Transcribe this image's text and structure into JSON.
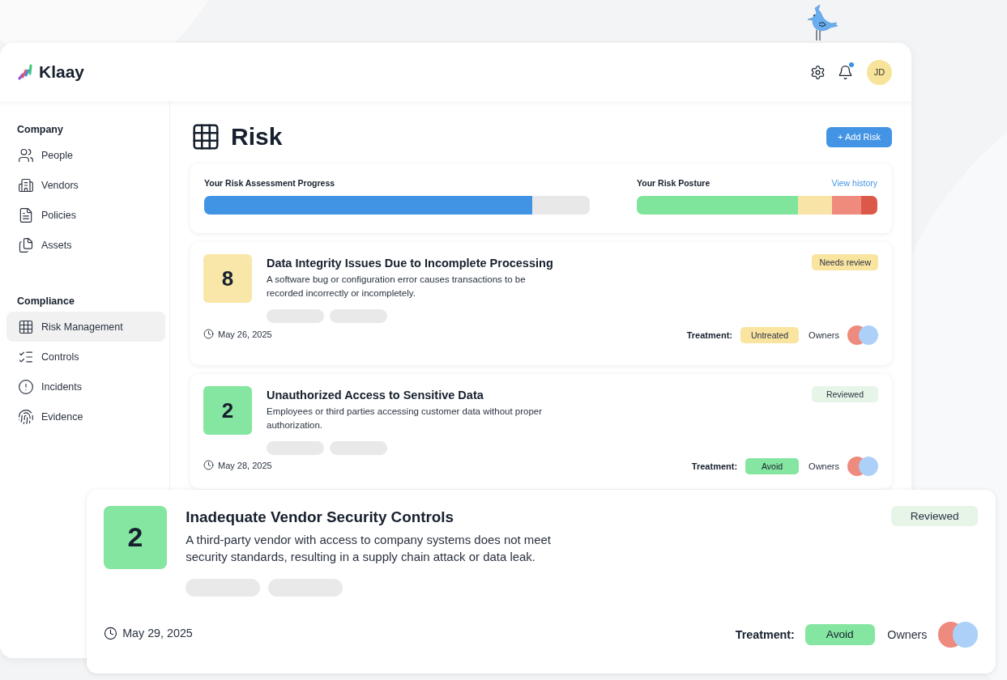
{
  "header": {
    "logo": "Klaay",
    "avatar": "JD"
  },
  "sidebar": {
    "sections": [
      {
        "title": "Company",
        "items": [
          {
            "label": "People",
            "selected": false
          },
          {
            "label": "Vendors",
            "selected": false
          },
          {
            "label": "Policies",
            "selected": false
          },
          {
            "label": "Assets",
            "selected": false
          }
        ]
      },
      {
        "title": "Compliance",
        "items": [
          {
            "label": "Risk Management",
            "selected": true
          },
          {
            "label": "Controls",
            "selected": false
          },
          {
            "label": "Incidents",
            "selected": false
          },
          {
            "label": "Evidence",
            "selected": false
          }
        ]
      }
    ]
  },
  "page": {
    "title": "Risk",
    "add_button": "+ Add Risk"
  },
  "progress": {
    "label": "Your Risk Assessment Progress",
    "level": 0.85
  },
  "posture": {
    "label": "Your Risk Posture",
    "link": "View history"
  },
  "risks": [
    {
      "score": "8",
      "color": "#f9e7a9",
      "title": "Data Integrity Issues Due to Incomplete Processing",
      "description": "A software bug or configuration error causes transactions to be recorded incorrectly or incompletely.",
      "status": {
        "text": "Needs review",
        "kind": "pending"
      },
      "date": "May 26, 2025",
      "treatment_label": "Treatment:",
      "treatment": {
        "text": "Untreated",
        "kind": "untreated"
      },
      "owners_label": "Owners"
    },
    {
      "score": "2",
      "color": "#84e6a0",
      "title": "Unauthorized Access to Sensitive Data",
      "description": "Employees or third parties accessing customer data without proper authorization.",
      "status": {
        "text": "Reviewed",
        "kind": "done"
      },
      "date": "May 28, 2025",
      "treatment_label": "Treatment:",
      "treatment": {
        "text": "Avoid",
        "kind": "avoid"
      },
      "owners_label": "Owners"
    }
  ],
  "featured_risk": {
    "score": "2",
    "color": "#84e6a0",
    "title": "Inadequate Vendor Security Controls",
    "description": "A third-party vendor with access to company systems does not meet security standards, resulting in a supply chain attack or data leak.",
    "status": {
      "text": "Reviewed",
      "kind": "done"
    },
    "date": "May 29, 2025",
    "treatment_label": "Treatment:",
    "treatment": {
      "text": "Avoid",
      "kind": "avoid"
    },
    "owners_label": "Owners"
  }
}
